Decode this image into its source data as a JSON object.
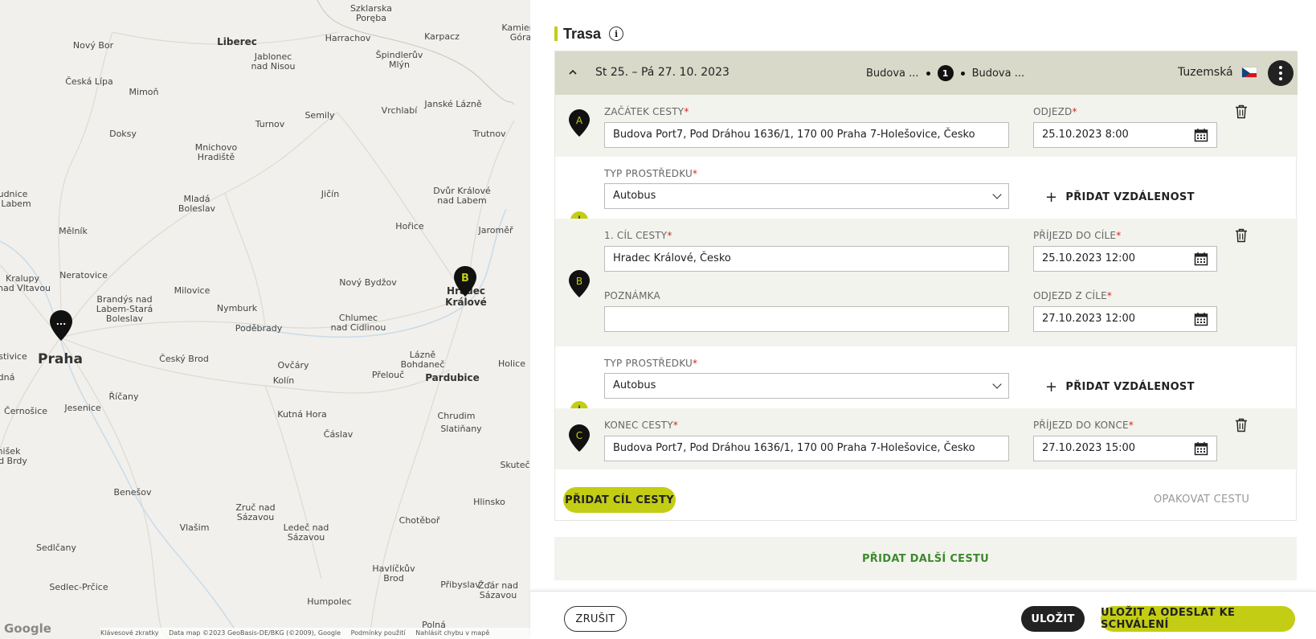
{
  "map": {
    "places": [
      {
        "name": "Szklarska",
        "cls": ""
      },
      {
        "name": "Poręba",
        "cls": ""
      },
      {
        "name": "Kamien",
        "cls": ""
      },
      {
        "name": "Góra",
        "cls": ""
      },
      {
        "name": "Nový Bor",
        "cls": ""
      },
      {
        "name": "Liberec",
        "cls": "mid"
      },
      {
        "name": "Harrachov",
        "cls": ""
      },
      {
        "name": "Karpacz",
        "cls": ""
      },
      {
        "name": "Jablonec",
        "cls": ""
      },
      {
        "name": "nad Nisou",
        "cls": ""
      },
      {
        "name": "Špindlerův",
        "cls": ""
      },
      {
        "name": "Mlýn",
        "cls": ""
      },
      {
        "name": "Česká Lípa",
        "cls": ""
      },
      {
        "name": "Mimoň",
        "cls": ""
      },
      {
        "name": "Vrchlabí",
        "cls": ""
      },
      {
        "name": "Janské Lázně",
        "cls": ""
      },
      {
        "name": "Turnov",
        "cls": ""
      },
      {
        "name": "Semily",
        "cls": ""
      },
      {
        "name": "Doksy",
        "cls": ""
      },
      {
        "name": "Trutnov",
        "cls": ""
      },
      {
        "name": "Mnichovo",
        "cls": ""
      },
      {
        "name": "Hradiště",
        "cls": ""
      },
      {
        "name": "udnice",
        "cls": ""
      },
      {
        "name": "Labem",
        "cls": ""
      },
      {
        "name": "Mladá",
        "cls": ""
      },
      {
        "name": "Boleslav",
        "cls": ""
      },
      {
        "name": "Jičín",
        "cls": ""
      },
      {
        "name": "Dvůr Králové",
        "cls": ""
      },
      {
        "name": "nad Labem",
        "cls": ""
      },
      {
        "name": "Mělník",
        "cls": ""
      },
      {
        "name": "Hořice",
        "cls": ""
      },
      {
        "name": "Jaroměř",
        "cls": ""
      },
      {
        "name": "Kralupy",
        "cls": ""
      },
      {
        "name": "nad Vltavou",
        "cls": ""
      },
      {
        "name": "Neratovice",
        "cls": ""
      },
      {
        "name": "Nový Bydžov",
        "cls": ""
      },
      {
        "name": "Milovice",
        "cls": ""
      },
      {
        "name": "Brandýs nad",
        "cls": ""
      },
      {
        "name": "Labem-Stará",
        "cls": ""
      },
      {
        "name": "Boleslav",
        "cls": ""
      },
      {
        "name": "Nymburk",
        "cls": ""
      },
      {
        "name": "Hradec",
        "cls": "mid"
      },
      {
        "name": "Králové",
        "cls": "mid"
      },
      {
        "name": "Chlumec",
        "cls": ""
      },
      {
        "name": "nad Cidlinou",
        "cls": ""
      },
      {
        "name": "Poděbrady",
        "cls": ""
      },
      {
        "name": "Praha",
        "cls": "big"
      },
      {
        "name": "stivice",
        "cls": ""
      },
      {
        "name": "Český Brod",
        "cls": ""
      },
      {
        "name": "Lázně",
        "cls": ""
      },
      {
        "name": "Bohdaneč",
        "cls": ""
      },
      {
        "name": "Holice",
        "cls": ""
      },
      {
        "name": "Ovčáry",
        "cls": ""
      },
      {
        "name": "dná",
        "cls": ""
      },
      {
        "name": "Přelouč",
        "cls": ""
      },
      {
        "name": "Pardubice",
        "cls": "mid"
      },
      {
        "name": "Kolín",
        "cls": ""
      },
      {
        "name": "Říčany",
        "cls": ""
      },
      {
        "name": "Černošice",
        "cls": ""
      },
      {
        "name": "Jesenice",
        "cls": ""
      },
      {
        "name": "Kutná Hora",
        "cls": ""
      },
      {
        "name": "Chrudim",
        "cls": ""
      },
      {
        "name": "Slatiňany",
        "cls": ""
      },
      {
        "name": "nišek",
        "cls": ""
      },
      {
        "name": "d Brdy",
        "cls": ""
      },
      {
        "name": "Čáslav",
        "cls": ""
      },
      {
        "name": "Skuteč",
        "cls": ""
      },
      {
        "name": "Benešov",
        "cls": ""
      },
      {
        "name": "Hlinsko",
        "cls": ""
      },
      {
        "name": "Zruč nad",
        "cls": ""
      },
      {
        "name": "Sázavou",
        "cls": ""
      },
      {
        "name": "Vlašim",
        "cls": ""
      },
      {
        "name": "Ledeč nad",
        "cls": ""
      },
      {
        "name": "Sázavou",
        "cls": ""
      },
      {
        "name": "Chotěboř",
        "cls": ""
      },
      {
        "name": "Sedlčany",
        "cls": ""
      },
      {
        "name": "Havlíčkův",
        "cls": ""
      },
      {
        "name": "Brod",
        "cls": ""
      },
      {
        "name": "Sedlec-Prčice",
        "cls": ""
      },
      {
        "name": "Přibyslav",
        "cls": ""
      },
      {
        "name": "Žďár nad",
        "cls": ""
      },
      {
        "name": "Sázavou",
        "cls": ""
      },
      {
        "name": "Humpolec",
        "cls": ""
      },
      {
        "name": "Polná",
        "cls": ""
      }
    ],
    "pin_praha_label": "...",
    "pin_b_label": "B",
    "google": "Google",
    "footer": [
      "Klávesové zkratky",
      "Data map ©2023 GeoBasis-DE/BKG (©2009), Google",
      "Podmínky použití",
      "Nahlásit chybu v mapě"
    ]
  },
  "panel": {
    "title": "Trasa",
    "info_glyph": "i",
    "trip": {
      "date_range": "St 25. – Pá 27. 10. 2023",
      "from_short": "Budova ...",
      "stop_count": "1",
      "to_short": "Budova ...",
      "type": "Tuzemská",
      "chevron": "^"
    },
    "start": {
      "marker": "A",
      "label": "ZAČÁTEK CESTY",
      "value": "Budova Port7, Pod Dráhou 1636/1, 170 00 Praha 7-Holešovice, Česko",
      "time_label": "ODJEZD",
      "time_value": "25.10.2023 8:00"
    },
    "transport1": {
      "label": "TYP PROSTŘEDKU",
      "value": "Autobus",
      "add_distance": "PŘIDAT VZDÁLENOST",
      "plus": "+"
    },
    "stop1": {
      "marker": "B",
      "label": "1. CÍL CESTY",
      "value": "Hradec Králové, Česko",
      "arrival_label": "PŘÍJEZD DO CÍLE",
      "arrival_value": "25.10.2023 12:00",
      "note_label": "POZNÁMKA",
      "note_value": "",
      "departure_label": "ODJEZD Z CÍLE",
      "departure_value": "27.10.2023 12:00"
    },
    "transport2": {
      "label": "TYP PROSTŘEDKU",
      "value": "Autobus",
      "add_distance": "PŘIDAT VZDÁLENOST",
      "plus": "+"
    },
    "end": {
      "marker": "C",
      "label": "KONEC CESTY",
      "value": "Budova Port7, Pod Dráhou 1636/1, 170 00 Praha 7-Holešovice, Česko",
      "time_label": "PŘÍJEZD DO KONCE",
      "time_value": "27.10.2023 15:00"
    },
    "required_mark": "*",
    "add_destination": "PŘIDAT CÍL CESTY",
    "repeat_trip": "OPAKOVAT CESTU",
    "add_another_trip": "PŘIDAT DALŠÍ CESTU"
  },
  "footer": {
    "cancel": "ZRUŠIT",
    "save": "ULOŽIT",
    "save_and_send": "ULOŽIT A ODESLAT KE SCHVÁLENÍ"
  },
  "colors": {
    "accent": "#c3cd14",
    "header_bg": "#d8d9c8",
    "row_grey": "#f3f3ee",
    "link_green": "#3c8a2e",
    "required": "#d0281e"
  }
}
